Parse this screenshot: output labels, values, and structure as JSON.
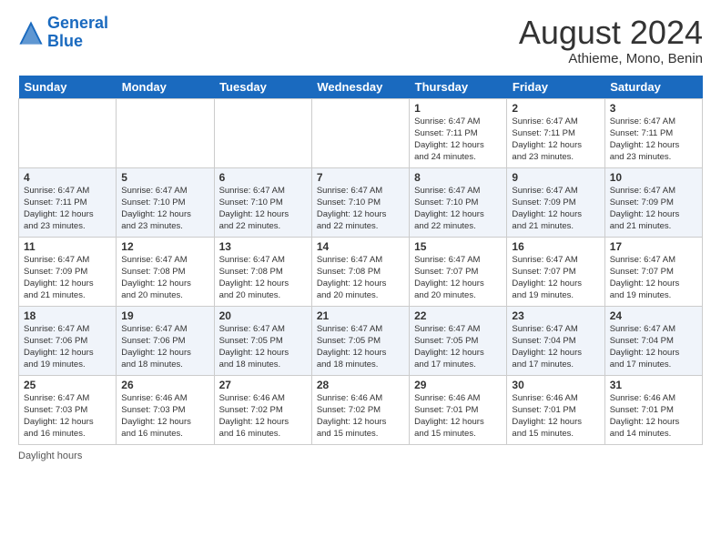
{
  "header": {
    "logo_line1": "General",
    "logo_line2": "Blue",
    "month_year": "August 2024",
    "location": "Athieme, Mono, Benin"
  },
  "footer": {
    "daylight_label": "Daylight hours"
  },
  "weekdays": [
    "Sunday",
    "Monday",
    "Tuesday",
    "Wednesday",
    "Thursday",
    "Friday",
    "Saturday"
  ],
  "weeks": [
    [
      {
        "day": "",
        "info": ""
      },
      {
        "day": "",
        "info": ""
      },
      {
        "day": "",
        "info": ""
      },
      {
        "day": "",
        "info": ""
      },
      {
        "day": "1",
        "info": "Sunrise: 6:47 AM\nSunset: 7:11 PM\nDaylight: 12 hours\nand 24 minutes."
      },
      {
        "day": "2",
        "info": "Sunrise: 6:47 AM\nSunset: 7:11 PM\nDaylight: 12 hours\nand 23 minutes."
      },
      {
        "day": "3",
        "info": "Sunrise: 6:47 AM\nSunset: 7:11 PM\nDaylight: 12 hours\nand 23 minutes."
      }
    ],
    [
      {
        "day": "4",
        "info": "Sunrise: 6:47 AM\nSunset: 7:11 PM\nDaylight: 12 hours\nand 23 minutes."
      },
      {
        "day": "5",
        "info": "Sunrise: 6:47 AM\nSunset: 7:10 PM\nDaylight: 12 hours\nand 23 minutes."
      },
      {
        "day": "6",
        "info": "Sunrise: 6:47 AM\nSunset: 7:10 PM\nDaylight: 12 hours\nand 22 minutes."
      },
      {
        "day": "7",
        "info": "Sunrise: 6:47 AM\nSunset: 7:10 PM\nDaylight: 12 hours\nand 22 minutes."
      },
      {
        "day": "8",
        "info": "Sunrise: 6:47 AM\nSunset: 7:10 PM\nDaylight: 12 hours\nand 22 minutes."
      },
      {
        "day": "9",
        "info": "Sunrise: 6:47 AM\nSunset: 7:09 PM\nDaylight: 12 hours\nand 21 minutes."
      },
      {
        "day": "10",
        "info": "Sunrise: 6:47 AM\nSunset: 7:09 PM\nDaylight: 12 hours\nand 21 minutes."
      }
    ],
    [
      {
        "day": "11",
        "info": "Sunrise: 6:47 AM\nSunset: 7:09 PM\nDaylight: 12 hours\nand 21 minutes."
      },
      {
        "day": "12",
        "info": "Sunrise: 6:47 AM\nSunset: 7:08 PM\nDaylight: 12 hours\nand 20 minutes."
      },
      {
        "day": "13",
        "info": "Sunrise: 6:47 AM\nSunset: 7:08 PM\nDaylight: 12 hours\nand 20 minutes."
      },
      {
        "day": "14",
        "info": "Sunrise: 6:47 AM\nSunset: 7:08 PM\nDaylight: 12 hours\nand 20 minutes."
      },
      {
        "day": "15",
        "info": "Sunrise: 6:47 AM\nSunset: 7:07 PM\nDaylight: 12 hours\nand 20 minutes."
      },
      {
        "day": "16",
        "info": "Sunrise: 6:47 AM\nSunset: 7:07 PM\nDaylight: 12 hours\nand 19 minutes."
      },
      {
        "day": "17",
        "info": "Sunrise: 6:47 AM\nSunset: 7:07 PM\nDaylight: 12 hours\nand 19 minutes."
      }
    ],
    [
      {
        "day": "18",
        "info": "Sunrise: 6:47 AM\nSunset: 7:06 PM\nDaylight: 12 hours\nand 19 minutes."
      },
      {
        "day": "19",
        "info": "Sunrise: 6:47 AM\nSunset: 7:06 PM\nDaylight: 12 hours\nand 18 minutes."
      },
      {
        "day": "20",
        "info": "Sunrise: 6:47 AM\nSunset: 7:05 PM\nDaylight: 12 hours\nand 18 minutes."
      },
      {
        "day": "21",
        "info": "Sunrise: 6:47 AM\nSunset: 7:05 PM\nDaylight: 12 hours\nand 18 minutes."
      },
      {
        "day": "22",
        "info": "Sunrise: 6:47 AM\nSunset: 7:05 PM\nDaylight: 12 hours\nand 17 minutes."
      },
      {
        "day": "23",
        "info": "Sunrise: 6:47 AM\nSunset: 7:04 PM\nDaylight: 12 hours\nand 17 minutes."
      },
      {
        "day": "24",
        "info": "Sunrise: 6:47 AM\nSunset: 7:04 PM\nDaylight: 12 hours\nand 17 minutes."
      }
    ],
    [
      {
        "day": "25",
        "info": "Sunrise: 6:47 AM\nSunset: 7:03 PM\nDaylight: 12 hours\nand 16 minutes."
      },
      {
        "day": "26",
        "info": "Sunrise: 6:46 AM\nSunset: 7:03 PM\nDaylight: 12 hours\nand 16 minutes."
      },
      {
        "day": "27",
        "info": "Sunrise: 6:46 AM\nSunset: 7:02 PM\nDaylight: 12 hours\nand 16 minutes."
      },
      {
        "day": "28",
        "info": "Sunrise: 6:46 AM\nSunset: 7:02 PM\nDaylight: 12 hours\nand 15 minutes."
      },
      {
        "day": "29",
        "info": "Sunrise: 6:46 AM\nSunset: 7:01 PM\nDaylight: 12 hours\nand 15 minutes."
      },
      {
        "day": "30",
        "info": "Sunrise: 6:46 AM\nSunset: 7:01 PM\nDaylight: 12 hours\nand 15 minutes."
      },
      {
        "day": "31",
        "info": "Sunrise: 6:46 AM\nSunset: 7:01 PM\nDaylight: 12 hours\nand 14 minutes."
      }
    ]
  ]
}
